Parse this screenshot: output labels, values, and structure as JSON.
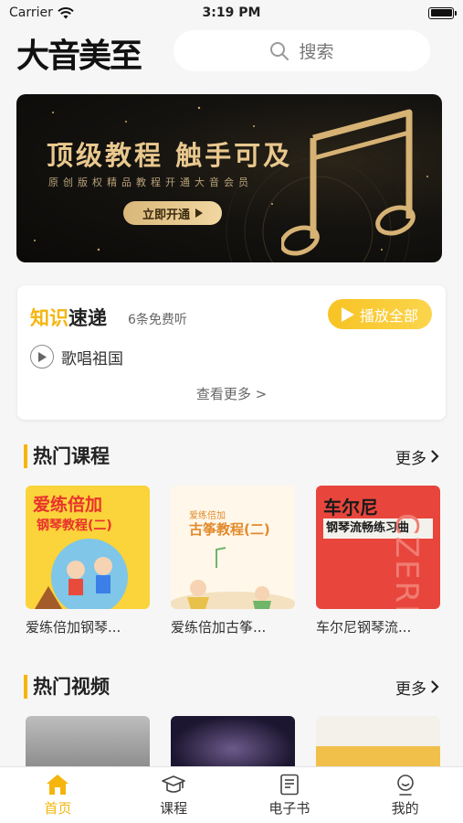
{
  "status": {
    "carrier": "Carrier",
    "time": "3:19 PM"
  },
  "header": {
    "logo_text": "大音美至",
    "search_placeholder": "搜索"
  },
  "banner": {
    "title": "顶级教程 触手可及",
    "subtitle": "原创版权精品教程开通大音会员",
    "button_label": "立即开通"
  },
  "knowledge": {
    "title_part1": "知识",
    "title_part2": "速递",
    "count_text": "6条免费听",
    "play_all_label": "播放全部",
    "track_title": "歌唱祖国",
    "see_more": "查看更多 >"
  },
  "hot_courses": {
    "title": "热门课程",
    "more_label": "更多",
    "items": [
      {
        "title": "爱练倍加钢琴...",
        "cover_line1": "爱练倍加",
        "cover_line2": "钢琴教程(二)"
      },
      {
        "title": "爱练倍加古筝...",
        "cover_line1": "爱练倍加",
        "cover_line2": "古筝教程(二)"
      },
      {
        "title": "车尔尼钢琴流...",
        "cover_line1": "车尔尼",
        "cover_line2": "钢琴流畅练习曲"
      }
    ]
  },
  "hot_videos": {
    "title": "热门视频",
    "more_label": "更多"
  },
  "tabbar": {
    "items": [
      {
        "label": "首页",
        "icon": "home-icon",
        "active": true
      },
      {
        "label": "课程",
        "icon": "graduation-cap-icon",
        "active": false
      },
      {
        "label": "电子书",
        "icon": "book-icon",
        "active": false
      },
      {
        "label": "我的",
        "icon": "user-icon",
        "active": false
      }
    ]
  },
  "colors": {
    "accent": "#f5b50d",
    "banner_gold": "#e9c88e"
  }
}
